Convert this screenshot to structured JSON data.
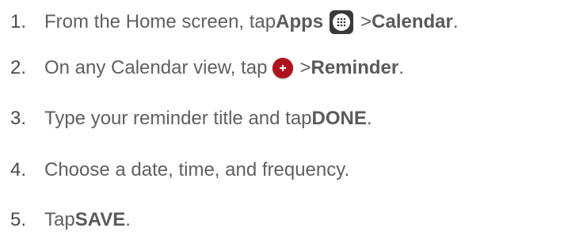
{
  "steps": [
    {
      "num": "1.",
      "parts": {
        "a": "From the Home screen, tap ",
        "b": "Apps",
        "c": " > ",
        "d": "Calendar",
        "e": "."
      },
      "icon": "apps-grid-icon"
    },
    {
      "num": "2.",
      "parts": {
        "a": "On any Calendar view, tap ",
        "c": " > ",
        "d": "Reminder",
        "e": "."
      },
      "icon": "add-plus-icon"
    },
    {
      "num": "3.",
      "parts": {
        "a": "Type your reminder title and tap ",
        "b": "DONE",
        "e": "."
      }
    },
    {
      "num": "4.",
      "parts": {
        "a": "Choose a date, time, and frequency."
      }
    },
    {
      "num": "5.",
      "parts": {
        "a": "Tap ",
        "b": "SAVE",
        "e": "."
      }
    }
  ],
  "colors": {
    "text": "#606060",
    "apps_icon_bg": "#3a3a3a",
    "plus_icon_bg": "#b0121b"
  }
}
